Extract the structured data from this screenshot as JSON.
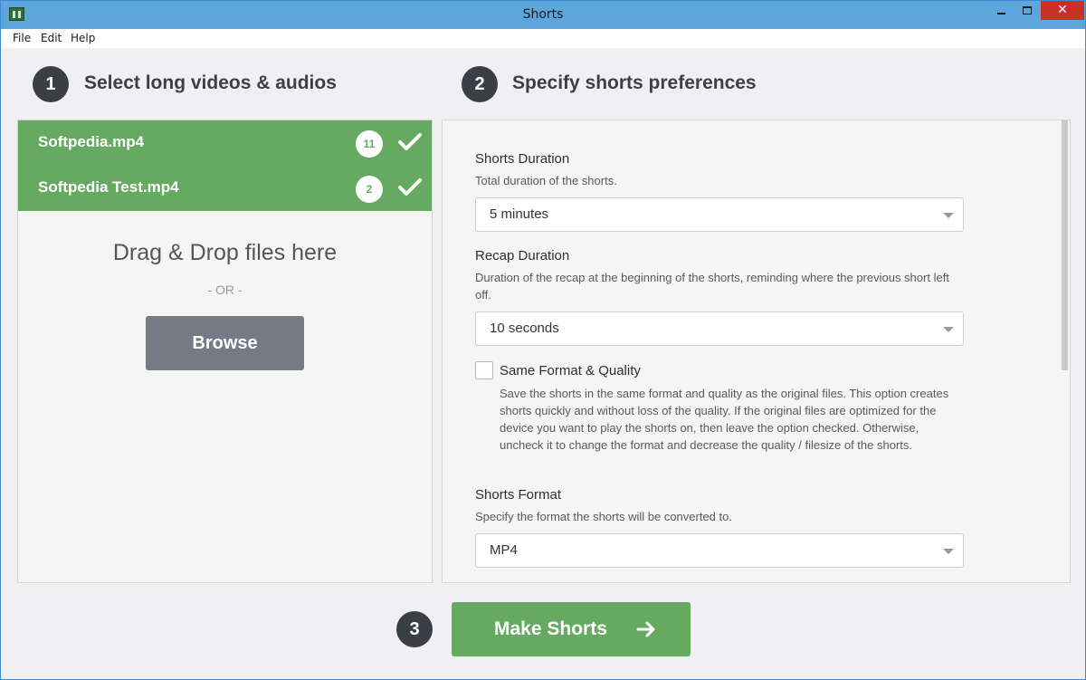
{
  "window": {
    "title": "Shorts"
  },
  "menu": [
    "File",
    "Edit",
    "Help"
  ],
  "step1": {
    "number": "1",
    "title": "Select long videos & audios"
  },
  "step2": {
    "number": "2",
    "title": "Specify shorts preferences"
  },
  "step3": {
    "number": "3"
  },
  "files": [
    {
      "name": "Softpedia.mp4",
      "count": "11"
    },
    {
      "name": "Softpedia Test.mp4",
      "count": "2"
    }
  ],
  "dropzone": {
    "text": "Drag & Drop files here",
    "or": "- OR -",
    "browse_label": "Browse"
  },
  "preferences": {
    "shorts_duration": {
      "label": "Shorts Duration",
      "desc": "Total duration of the shorts.",
      "value": "5 minutes"
    },
    "recap_duration": {
      "label": "Recap Duration",
      "desc": "Duration of the recap at the beginning of the shorts, reminding where the previous short left off.",
      "value": "10 seconds"
    },
    "same_format": {
      "label": "Same Format & Quality",
      "checked": false,
      "desc": "Save the shorts in the same format and quality as the original files. This option creates shorts quickly and without loss of the quality. If the original files are optimized for the device you want to play the shorts on, then leave the option checked. Otherwise, uncheck it to change the format and decrease the quality / filesize of the shorts."
    },
    "shorts_format": {
      "label": "Shorts Format",
      "desc": "Specify the format the shorts will be converted to.",
      "value": "MP4"
    }
  },
  "action": {
    "make_label": "Make Shorts"
  },
  "colors": {
    "accent_green": "#66aa61",
    "browse_gray": "#767a84",
    "step_dark": "#3b3f44",
    "titlebar_blue": "#5ca6dc"
  },
  "icons": [
    "app-icon",
    "check-icon",
    "arrow-right-icon",
    "dropdown-arrow-icon"
  ]
}
